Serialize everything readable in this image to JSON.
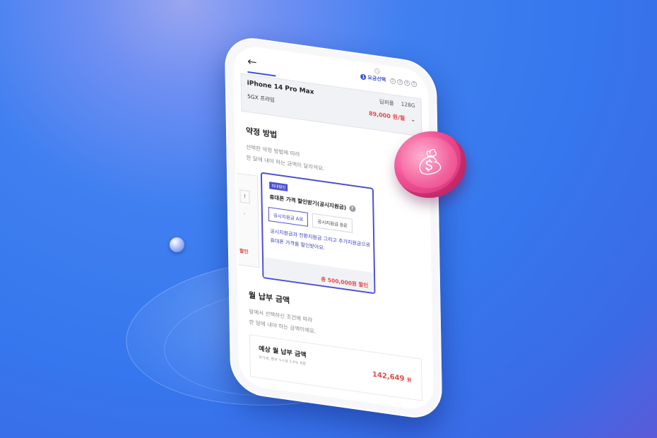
{
  "header": {
    "back_icon": "arrow-left-icon",
    "steps": {
      "active_label": "요금선택",
      "active_number": "1",
      "others": [
        "2",
        "3",
        "4",
        "5"
      ]
    }
  },
  "device": {
    "name": "iPhone 14 Pro Max",
    "color": "딥퍼플",
    "storage": "128G",
    "plan_name": "5GX 프라임",
    "plan_price": "89,000 원/월"
  },
  "contract": {
    "title": "약정 방법",
    "desc_line1": "선택한 약정 방법에 따라",
    "desc_line2": "한 달에 내야 하는 금액이 달라져요.",
    "side_option_label": "할인",
    "main_option": {
      "badge": "최대할인",
      "title": "휴대폰 가격 할인받기(공시지원금)",
      "buttons": [
        "공시지원금 A로",
        "공시지원금 B로"
      ],
      "desc": "공시지원금과 전환지원금 그리고 추가지원금으로 휴대폰 가격을 할인받아요.",
      "total": "총 500,000원 할인"
    }
  },
  "monthly": {
    "title": "월 납부 금액",
    "desc_line1": "앞에서 선택하신 조건에 따라",
    "desc_line2": "한 달에 내야 하는 금액이에요.",
    "card_title": "예상 월 납부 금액",
    "card_sub": "부가세, 할부 수수료 5.9% 포함",
    "amount": "142,649",
    "unit": "원"
  },
  "decor": {
    "percent_symbol": "%",
    "coin_icon": "money-bag-icon"
  },
  "colors": {
    "accent": "#4b4fd0",
    "price_red": "#e24a4a",
    "coin_pink": "#f04f93",
    "background_blue": "#3677ee"
  }
}
